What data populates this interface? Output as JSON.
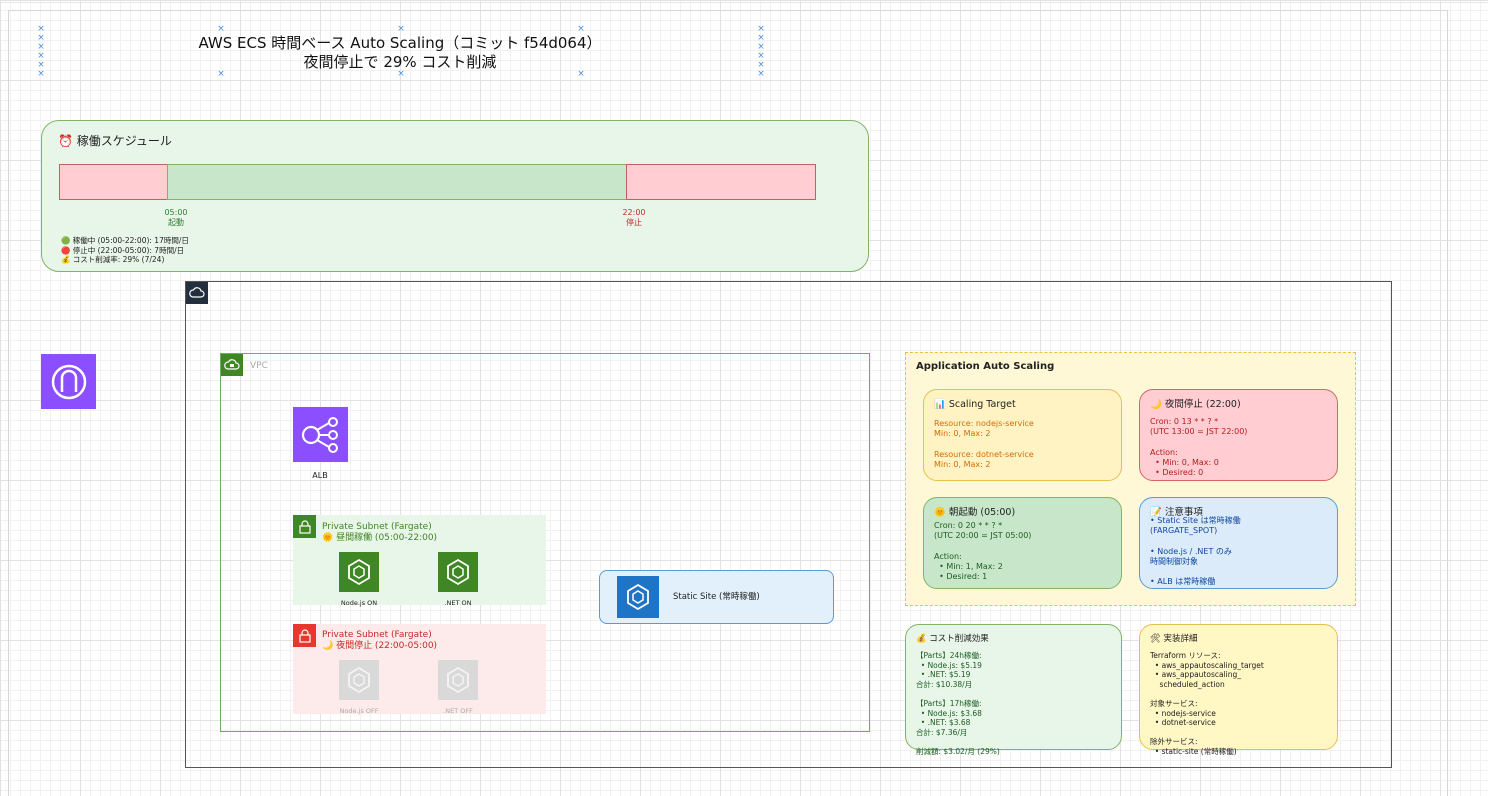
{
  "title": {
    "line1": "AWS ECS 時間ベース Auto Scaling（コミット f54d064）",
    "line2": "夜間停止で 29% コスト削減"
  },
  "schedule": {
    "header": "⏰ 稼働スケジュール",
    "start_time": "05:00",
    "start_label": "起動",
    "stop_time": "22:00",
    "stop_label": "停止",
    "legend": [
      "🟢 稼働中 (05:00-22:00): 17時間/日",
      "🔴 停止中 (22:00-05:00): 7時間/日",
      "💰 コスト削減率: 29% (7/24)"
    ],
    "colors": {
      "stopped": "#ffcdd2",
      "running": "#c8e6c9"
    }
  },
  "vpc": {
    "label": "VPC"
  },
  "alb": {
    "label": "ALB",
    "color": "#8c4fff"
  },
  "subnet_day": {
    "title": "Private Subnet (Fargate)",
    "subtitle": "🌞 昼間稼働 (05:00-22:00)",
    "tasks": [
      "Node.js ON",
      ".NET ON"
    ],
    "color": "#3f8624"
  },
  "subnet_night": {
    "title": "Private Subnet (Fargate)",
    "subtitle": "🌙 夜間停止 (22:00-05:00)",
    "tasks": [
      "Node.js OFF",
      ".NET OFF"
    ],
    "color": "#e7372f"
  },
  "static_site": {
    "label": "Static Site (常時稼働)"
  },
  "auto_scaling": {
    "title": "Application Auto Scaling",
    "target": {
      "header": "📊 Scaling Target",
      "lines": [
        "Resource: nodejs-service",
        "Min: 0, Max: 2",
        "",
        "Resource: dotnet-service",
        "Min: 0, Max: 2"
      ]
    },
    "night": {
      "header": "🌙 夜間停止 (22:00)",
      "lines": [
        "Cron: 0 13 * * ? *",
        "(UTC 13:00 = JST 22:00)",
        "",
        "Action:",
        "  • Min: 0, Max: 0",
        "  • Desired: 0"
      ]
    },
    "morning": {
      "header": "🌞 朝起動 (05:00)",
      "lines": [
        "Cron: 0 20 * * ? *",
        "(UTC 20:00 = JST 05:00)",
        "",
        "Action:",
        "  • Min: 1, Max: 2",
        "  • Desired: 1"
      ]
    },
    "notes": {
      "header": "📝 注意事項",
      "lines": [
        "• Static Site は常時稼働",
        "(FARGATE_SPOT)",
        "",
        "• Node.js / .NET のみ",
        "時間制御対象",
        "",
        "• ALB は常時稼働"
      ]
    }
  },
  "cost": {
    "header": "💰 コスト削減効果",
    "lines": [
      "【Parts】24h稼働:",
      "  • Node.js: $5.19",
      "  • .NET: $5.19",
      "合計: $10.38/月",
      "",
      "【Parts】17h稼働:",
      "  • Node.js: $3.68",
      "  • .NET: $3.68",
      "合計: $7.36/月",
      "",
      "削減額: $3.02/月 (29%)"
    ]
  },
  "impl": {
    "header": "🛠 実装詳細",
    "lines": [
      "Terraform リソース:",
      "  • aws_appautoscaling_target",
      "  • aws_appautoscaling_",
      "    scheduled_action",
      "",
      "対象サービス:",
      "  • nodejs-service",
      "  • dotnet-service",
      "",
      "除外サービス:",
      "  • static-site (常時稼働)"
    ]
  }
}
